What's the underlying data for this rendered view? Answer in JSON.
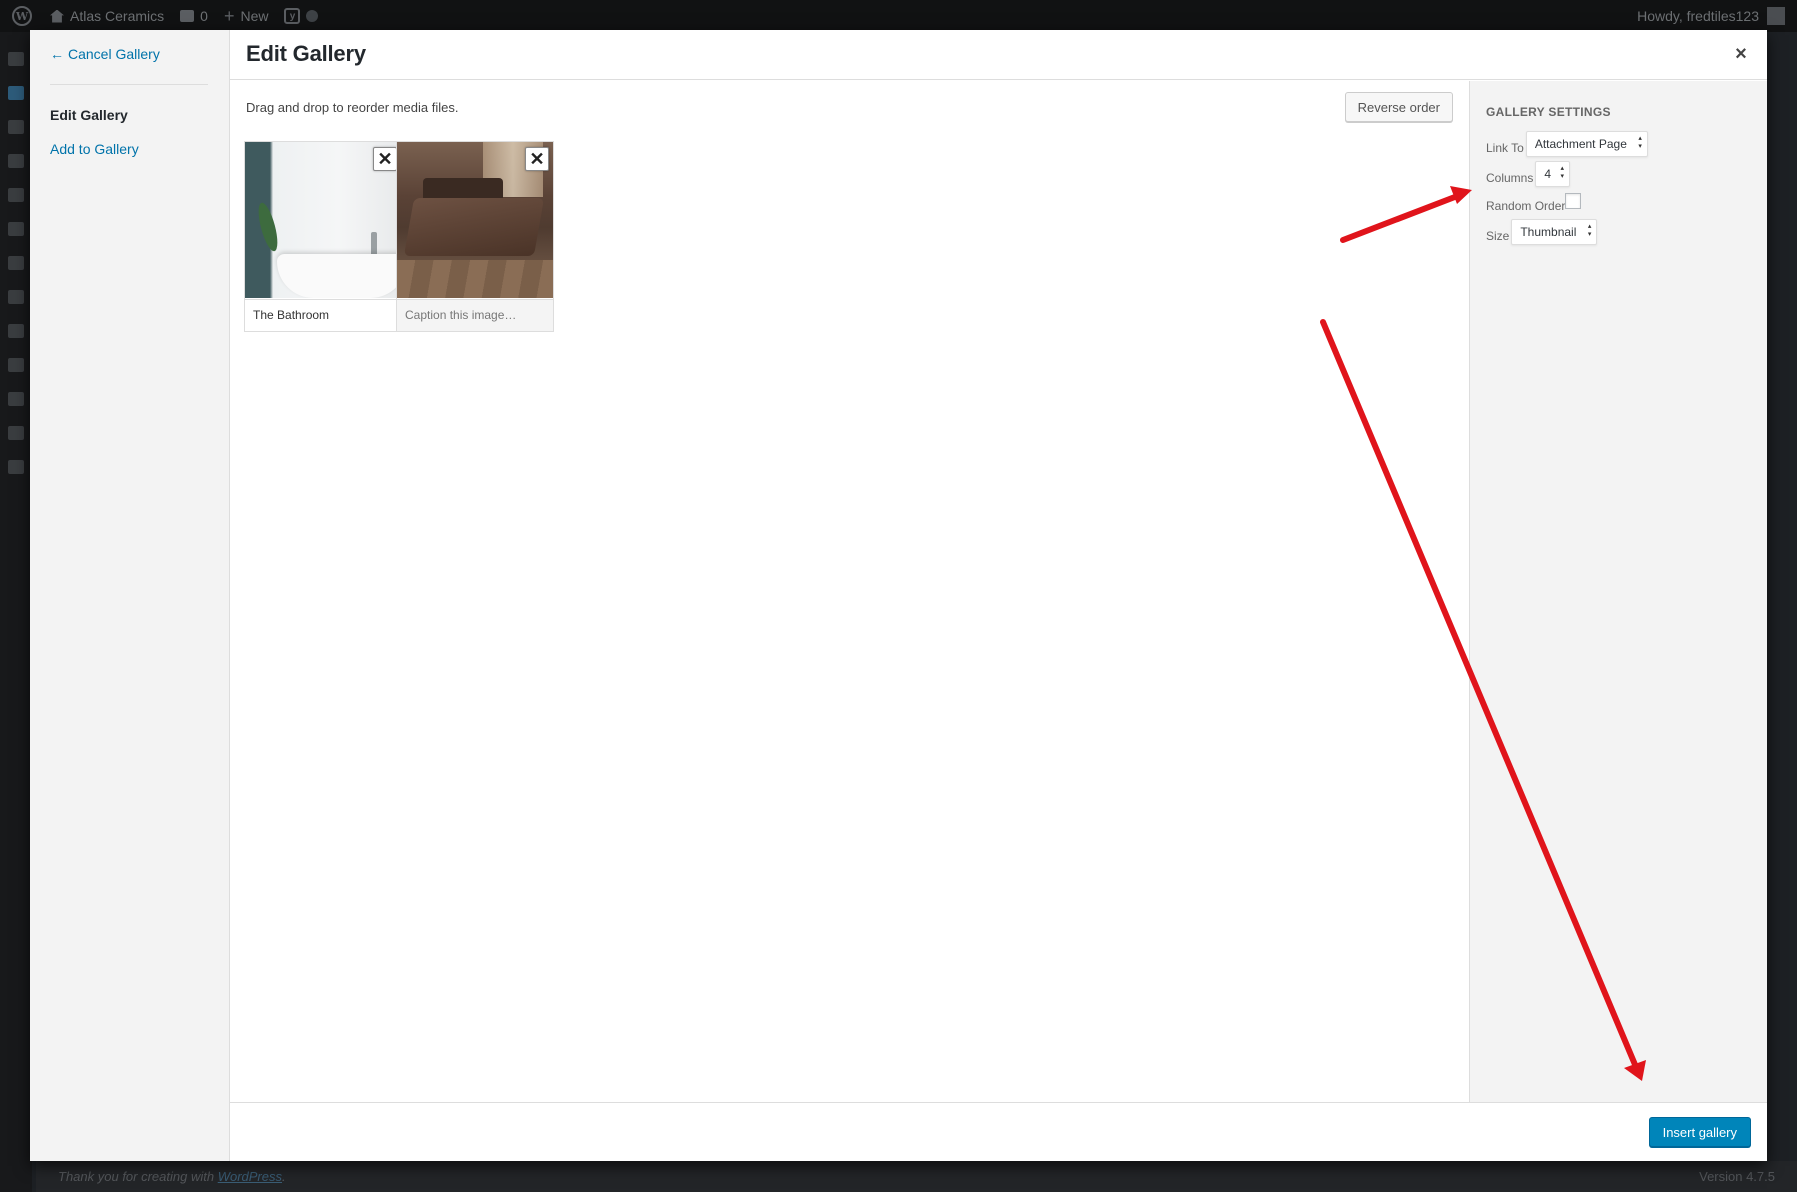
{
  "admin_bar": {
    "site_name": "Atlas Ceramics",
    "comments_count": "0",
    "new_label": "New",
    "greeting": "Howdy, fredtiles123"
  },
  "footer": {
    "thank_you_prefix": "Thank you for creating with ",
    "wordpress_link": "WordPress",
    "thank_you_suffix": ".",
    "version": "Version 4.7.5"
  },
  "modal": {
    "cancel_label": "Cancel Gallery",
    "menu": {
      "edit_gallery": "Edit Gallery",
      "add_to_gallery": "Add to Gallery"
    },
    "title": "Edit Gallery",
    "close_glyph": "×",
    "instructions": "Drag and drop to reorder media files.",
    "reverse_order_label": "Reverse order",
    "attachments": [
      {
        "caption": "The Bathroom",
        "placeholder": "Caption this image…",
        "image": "bathroom"
      },
      {
        "caption": "",
        "placeholder": "Caption this image…",
        "image": "bedroom"
      }
    ],
    "settings": {
      "heading": "Gallery Settings",
      "link_to_label": "Link To",
      "link_to_value": "Attachment Page",
      "columns_label": "Columns",
      "columns_value": "4",
      "random_order_label": "Random Order",
      "random_order_checked": false,
      "size_label": "Size",
      "size_value": "Thumbnail"
    },
    "insert_label": "Insert gallery"
  },
  "colors": {
    "accent": "#0073aa",
    "primary_button": "#0085ba",
    "annotation_arrow": "#e0141b"
  }
}
